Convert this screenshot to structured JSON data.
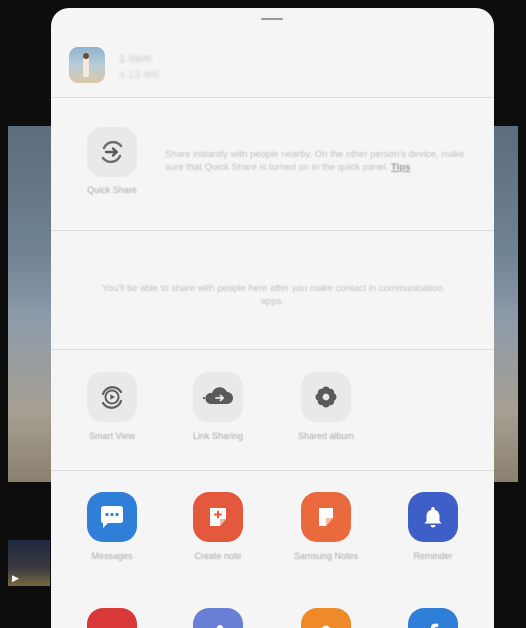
{
  "file": {
    "name": "1 item",
    "size": "4.13 MB"
  },
  "quick_share": {
    "label": "Quick Share",
    "description": "Share instantly with people nearby. On the other person's device, make sure that Quick Share is turned on in the quick panel.",
    "tips_label": "Tips"
  },
  "contacts": {
    "message": "You'll be able to share with people here after you make contact in communication apps."
  },
  "share_options": [
    {
      "label": "Smart View",
      "icon": "smart-view-icon"
    },
    {
      "label": "Link Sharing",
      "icon": "link-sharing-icon"
    },
    {
      "label": "Shared album",
      "icon": "shared-album-icon"
    }
  ],
  "apps": [
    {
      "label": "Messages",
      "icon": "messages-icon",
      "color": "#2f7fd8"
    },
    {
      "label": "Create note",
      "icon": "create-note-icon",
      "color": "#e4593d"
    },
    {
      "label": "Samsung Notes",
      "icon": "samsung-notes-icon",
      "color": "#ea6a3e"
    },
    {
      "label": "Reminder",
      "icon": "reminder-icon",
      "color": "#3f5fc8"
    }
  ],
  "apps_row2_colors": [
    "#d9383a",
    "#6a7fd6",
    "#ef8a2a",
    "#2f7fd8"
  ]
}
